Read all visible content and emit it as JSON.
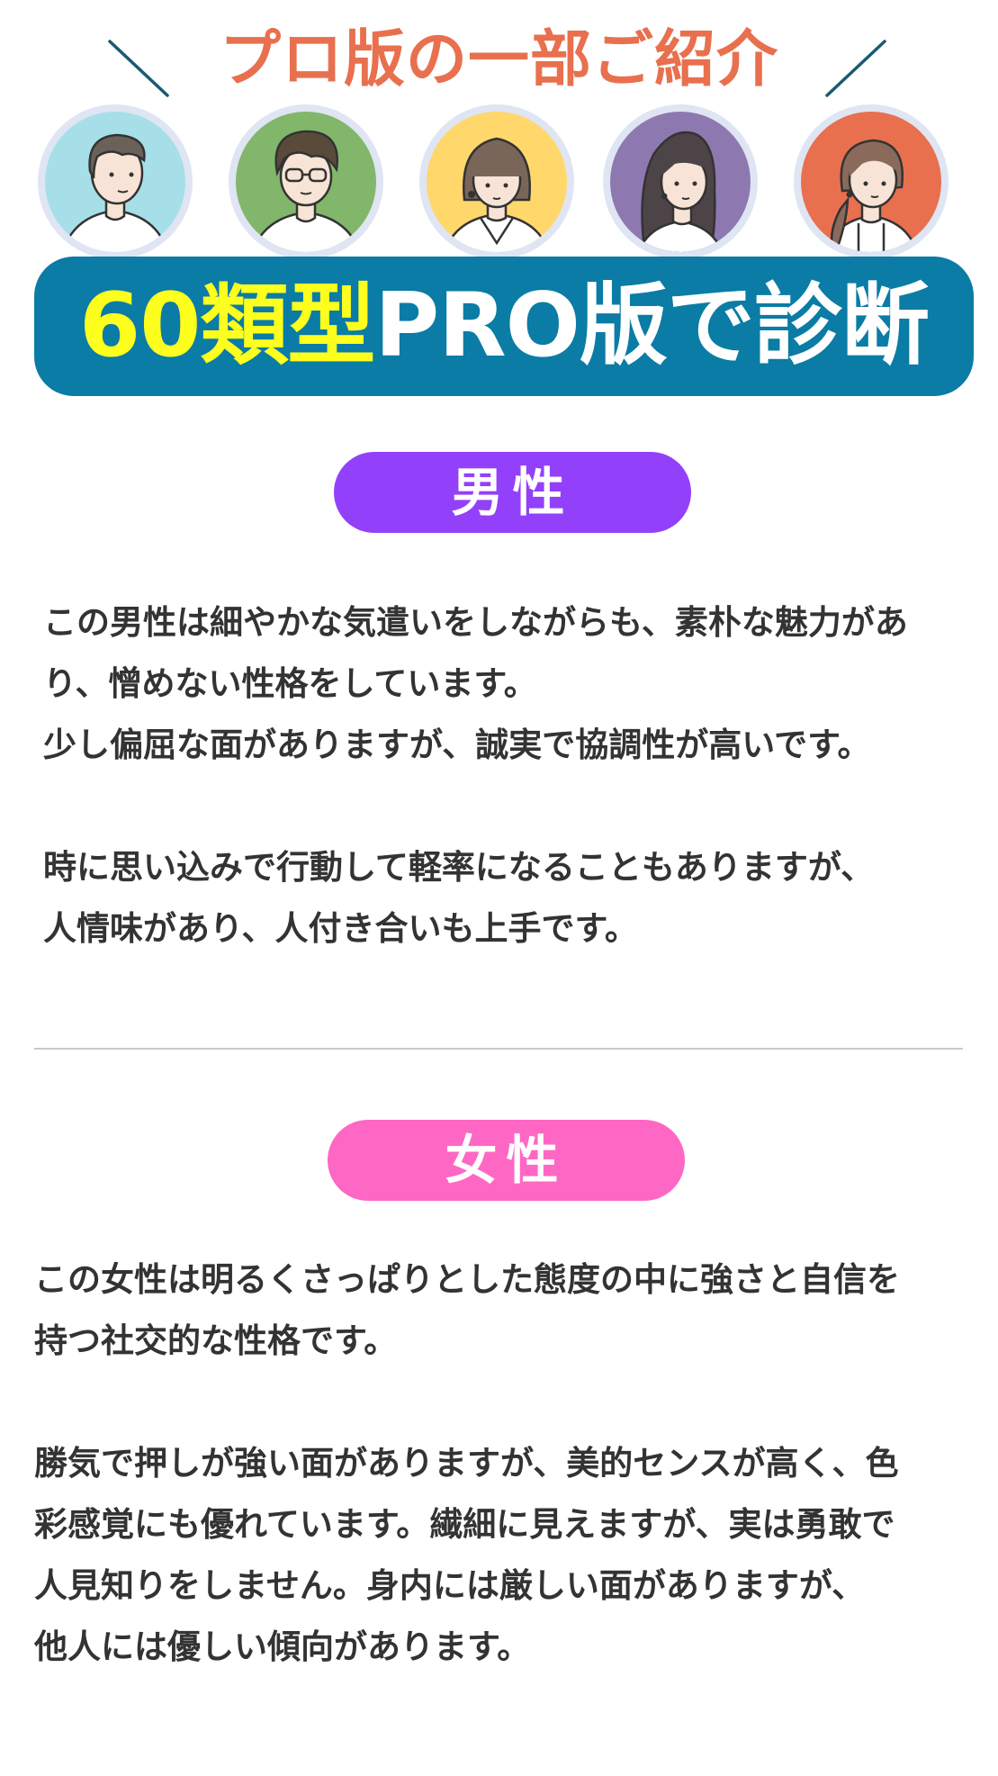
{
  "header": {
    "title": "プロ版の一部ご紹介",
    "accent_color": "#e8704e",
    "slash_color": "#1a5a73"
  },
  "avatars": [
    {
      "name": "male-avatar-1",
      "bg": "#a6dfe8"
    },
    {
      "name": "male-avatar-2",
      "bg": "#82b66b"
    },
    {
      "name": "female-avatar-1",
      "bg": "#ffd76b"
    },
    {
      "name": "female-avatar-2",
      "bg": "#8d79b0"
    },
    {
      "name": "female-avatar-3",
      "bg": "#e8704e"
    }
  ],
  "banner": {
    "highlight": "60類型",
    "rest": "PRO版で診断",
    "bg_color": "#0a7ca5",
    "highlight_color": "#ffff1e"
  },
  "male": {
    "label": "男性",
    "color": "#9340fb",
    "para1": [
      "この男性は細やかな気遣いをしながらも、素朴な魅力があ",
      "り、憎めない性格をしています。",
      "少し偏屈な面がありますが、誠実で協調性が高いです。"
    ],
    "para2": [
      "時に思い込みで行動して軽率になることもありますが、",
      "人情味があり、人付き合いも上手です。"
    ]
  },
  "female": {
    "label": "女性",
    "color": "#ff67c4",
    "para1": [
      "この女性は明るくさっぱりとした態度の中に強さと自信を",
      "持つ社交的な性格です。"
    ],
    "para2": [
      "勝気で押しが強い面がありますが、美的センスが高く、色",
      "彩感覚にも優れています。繊細に見えますが、実は勇敢で",
      "人見知りをしません。身内には厳しい面がありますが、",
      "他人には優しい傾向があります。"
    ]
  }
}
